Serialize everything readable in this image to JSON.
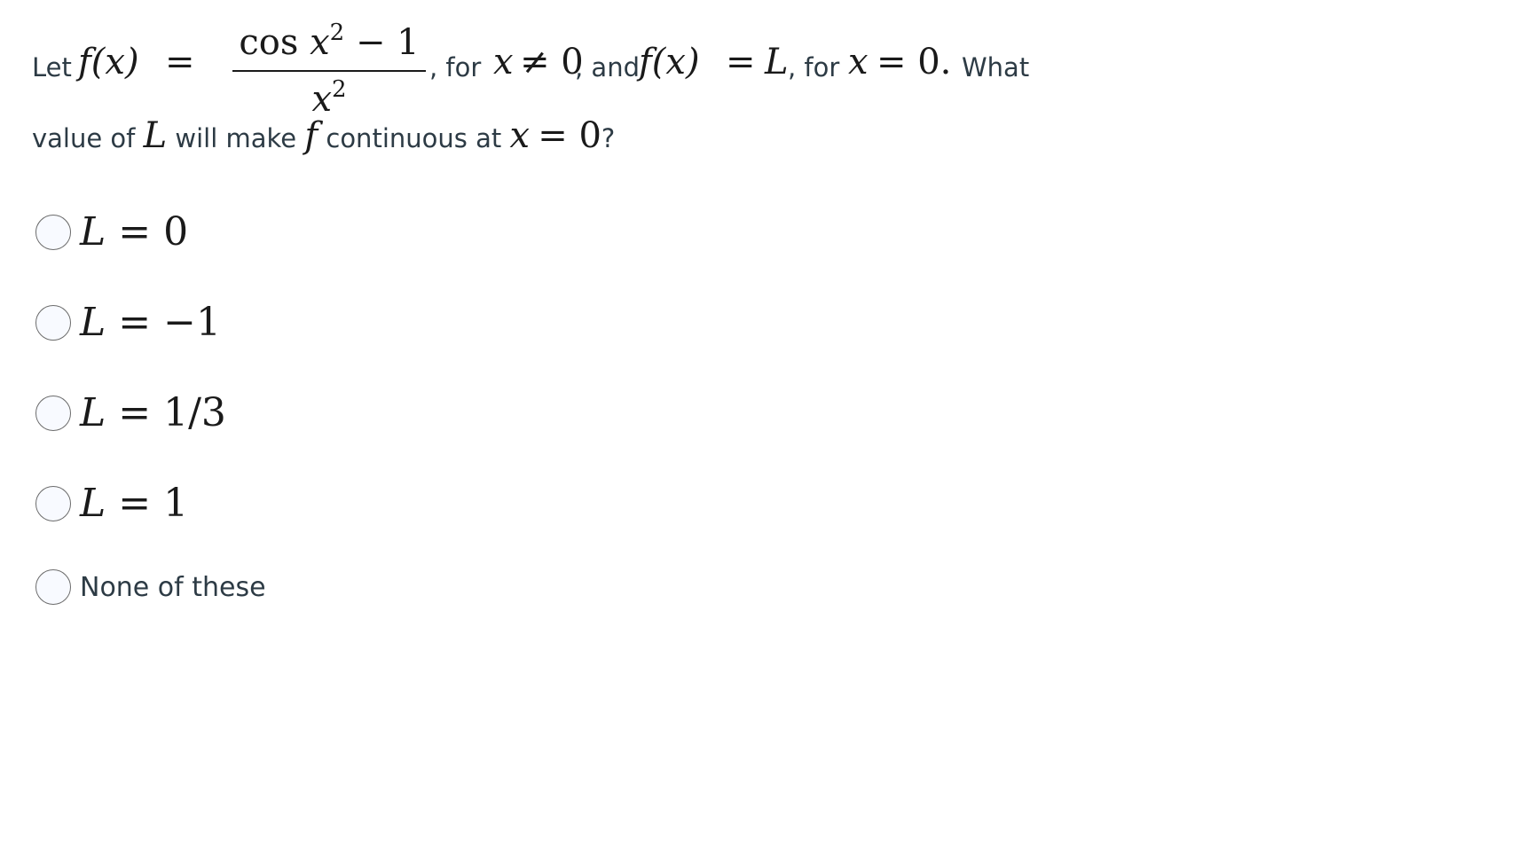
{
  "question": {
    "text_let": "Let",
    "f_of_x": "f(x)",
    "equals": "=",
    "numerator_func": "cos",
    "numerator_var": "x",
    "numerator_exp": "2",
    "numerator_rest": "− 1",
    "denominator_var": "x",
    "denominator_exp": "2",
    "text_for1": ", for",
    "cond1_var": "x",
    "cond1_rel": "≠ 0",
    "text_and": ", and",
    "f_of_x2": "f(x)",
    "eq2": "=",
    "L": "L",
    "text_for2": ", for",
    "cond2_var": "x",
    "cond2_rel": "= 0.",
    "text_what": "What",
    "text_value_of": "value of",
    "L2": "L",
    "text_will_make": "will make",
    "f": "f",
    "text_continuous_at": "continuous at",
    "cond3_var": "x",
    "cond3_rel": "= 0",
    "text_qmark": "?"
  },
  "options": [
    {
      "var": "L",
      "rest": "= 0"
    },
    {
      "var": "L",
      "rest": "= −1"
    },
    {
      "var": "L",
      "rest": "= 1/3"
    },
    {
      "var": "L",
      "rest": "= 1"
    },
    {
      "text": "None of these"
    }
  ]
}
